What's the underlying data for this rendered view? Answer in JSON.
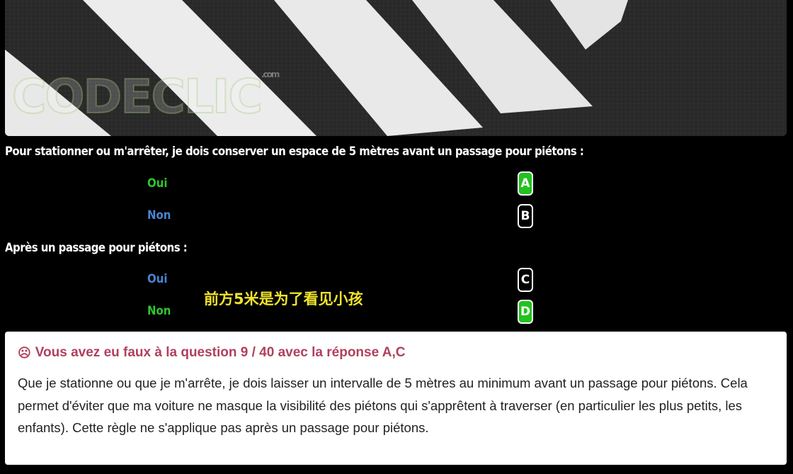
{
  "header_image": {
    "logo": {
      "text": "CODECLIC",
      "suffix": ".com"
    }
  },
  "questions": [
    {
      "prompt": "Pour stationner ou m'arrêter, je dois conserver un espace de 5 mètres avant un passage pour piétons :",
      "answers": [
        {
          "label": "Oui",
          "key": "A",
          "key_selected": true,
          "color": "#2fc52f"
        },
        {
          "label": "Non",
          "key": "B",
          "key_selected": false,
          "color": "#4a84d2"
        }
      ]
    },
    {
      "prompt": "Après un passage pour piétons :",
      "answers": [
        {
          "label": "Oui",
          "key": "C",
          "key_selected": false,
          "color": "#4a84d2"
        },
        {
          "label": "Non",
          "key": "D",
          "key_selected": true,
          "color": "#2fc52f"
        }
      ]
    }
  ],
  "annotation": "前方5米是为了看见小孩",
  "result": {
    "icon": "sad-face-icon",
    "title": "Vous avez eu faux à la question 9 / 40 avec la réponse A,C",
    "explanation": "Que je stationne ou que je m'arrête, je dois laisser un intervalle de 5 mètres au minimum avant un passage pour piétons. Cela permet d'éviter que ma voiture ne masque la visibilité des piétons qui s'apprêtent à traverser (en particulier les plus petits, les enfants). Cette règle ne s'applique pas après un passage pour piétons."
  },
  "colors": {
    "selected_key": "#22c21f",
    "title_red": "#b0405e",
    "annotation_yellow": "#f0e32a"
  }
}
